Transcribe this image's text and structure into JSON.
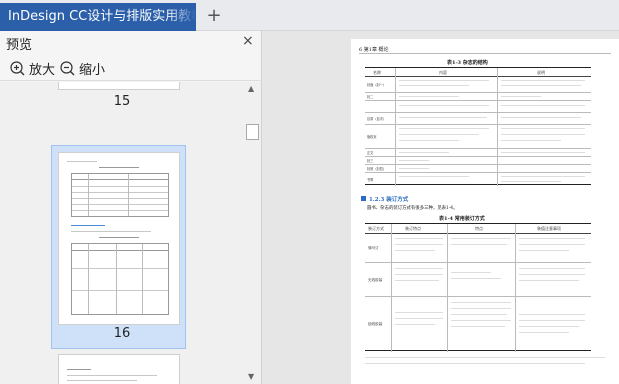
{
  "tab": {
    "title": "InDesign CC设计与排版实用教程",
    "new_tab_symbol": "+"
  },
  "panel": {
    "title": "预览",
    "close_symbol": "×",
    "zoom_in_label": "放大",
    "zoom_out_label": "缩小",
    "page_numbers": [
      "15",
      "16"
    ]
  },
  "document": {
    "running_head": "6  第1章  概论",
    "table1_title": "表1-3  杂志的结构",
    "table1_headers": [
      "名称",
      "内容",
      "说明"
    ],
    "table1_rows": [
      [
        "封面（封一）",
        "",
        ""
      ],
      [
        "封二",
        "",
        ""
      ],
      [
        "目录（目次）",
        "",
        ""
      ],
      [
        "版权页",
        "",
        ""
      ],
      [
        "正文",
        "",
        ""
      ],
      [
        "封三",
        "",
        ""
      ],
      [
        "封底（封四）",
        "",
        ""
      ],
      [
        "书脊",
        "",
        ""
      ]
    ],
    "section_heading": "1.2.3  装订方式",
    "section_intro": "圆书、杂志的装订方式有很多三种，见表1-4。",
    "table2_title": "表1-4  常用装订方式",
    "table2_headers": [
      "装订方式",
      "装订特点",
      "特点",
      "装值注意事项"
    ],
    "table2_rows": [
      "骑马订",
      "无线胶装",
      "锁线胶装"
    ]
  },
  "colors": {
    "tab_bg": "#2b5faa",
    "selection_bg": "#cfe1f8",
    "panel_bg": "#f5f5f5"
  }
}
